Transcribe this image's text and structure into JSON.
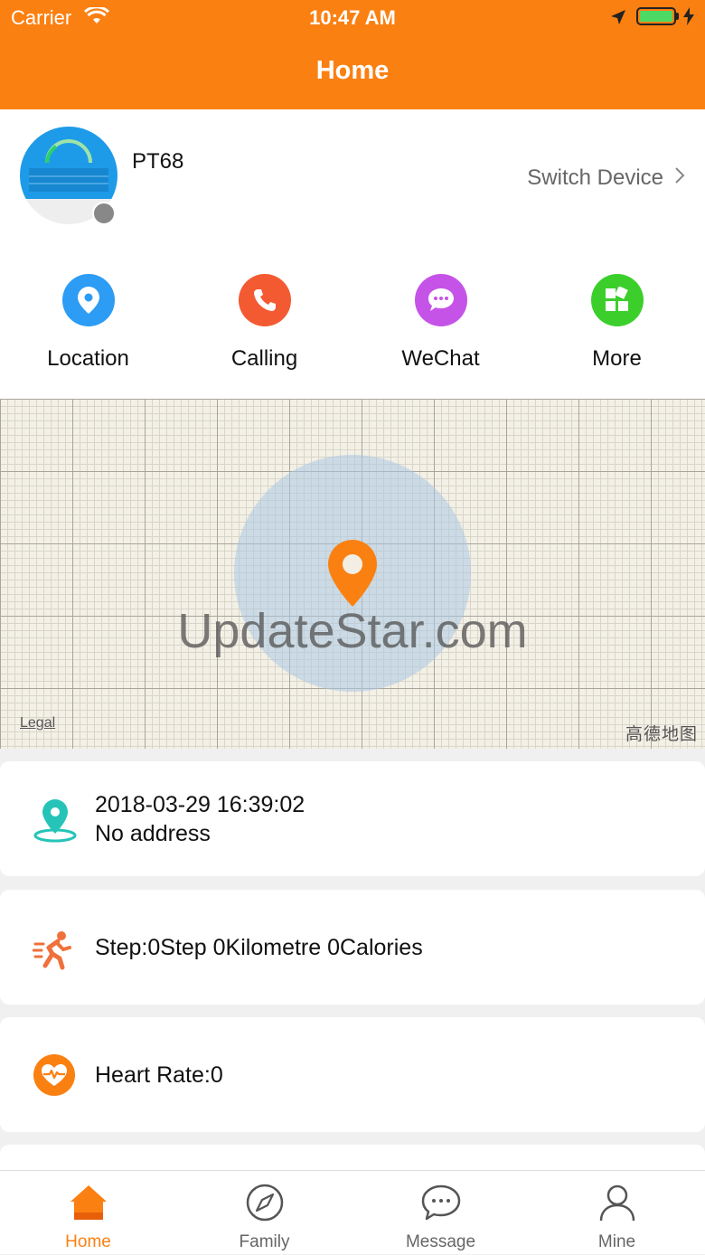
{
  "status_bar": {
    "carrier": "Carrier",
    "time": "10:47 AM"
  },
  "header": {
    "title": "Home"
  },
  "device": {
    "name": "PT68",
    "switch_label": "Switch Device"
  },
  "quick_actions": [
    {
      "label": "Location",
      "icon": "location-pin-icon",
      "color": "#2d9cf4"
    },
    {
      "label": "Calling",
      "icon": "phone-icon",
      "color": "#f45a31"
    },
    {
      "label": "WeChat",
      "icon": "chat-bubble-icon",
      "color": "#c653e8"
    },
    {
      "label": "More",
      "icon": "grid-icon",
      "color": "#3ccf2c"
    }
  ],
  "map": {
    "watermark": "UpdateStar.com",
    "legal": "Legal",
    "brand": "高德地图",
    "accent": "#fb8012"
  },
  "cards": {
    "location": {
      "timestamp": "2018-03-29 16:39:02",
      "address": "No address"
    },
    "steps": {
      "text": "Step:0Step 0Kilometre 0Calories"
    },
    "heart": {
      "text": "Heart Rate:0"
    }
  },
  "tabs": [
    {
      "label": "Home",
      "active": true
    },
    {
      "label": "Family",
      "active": false
    },
    {
      "label": "Message",
      "active": false
    },
    {
      "label": "Mine",
      "active": false
    }
  ]
}
